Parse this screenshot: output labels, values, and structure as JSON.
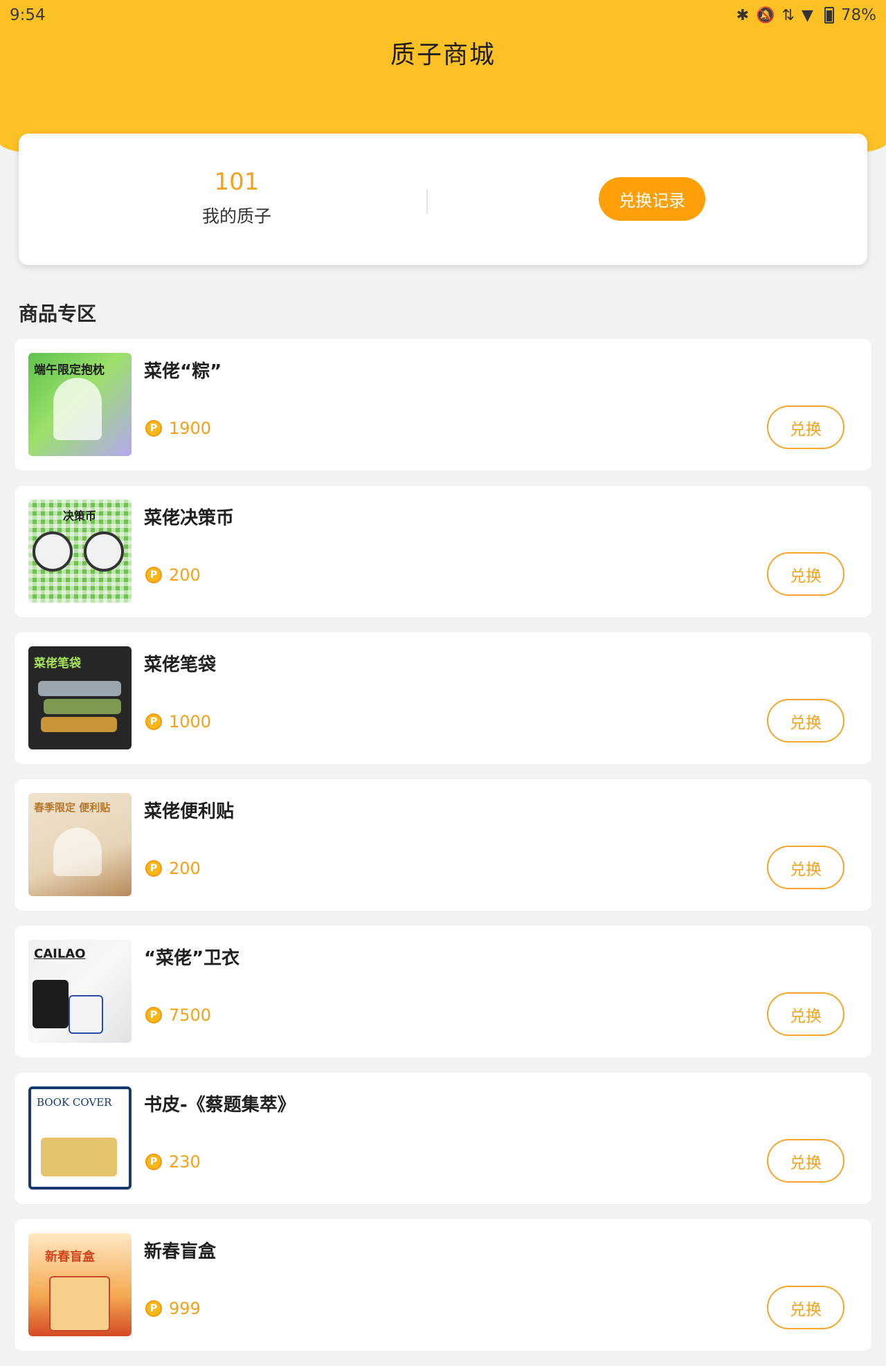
{
  "status_bar": {
    "time": "9:54",
    "battery": "78%",
    "icons": [
      "bluetooth-icon",
      "bell-off-icon",
      "data-arrows-icon",
      "wifi-icon",
      "battery-icon"
    ]
  },
  "header": {
    "title": "质子商城"
  },
  "summary": {
    "points_value": "101",
    "points_label": "我的质子",
    "history_button": "兑换记录"
  },
  "section_title": "商品专区",
  "products": [
    {
      "name": "菜佬“粽”",
      "price": "1900",
      "button": "兑换",
      "thumb_text": "端午限定抱枕"
    },
    {
      "name": "菜佬决策币",
      "price": "200",
      "button": "兑换",
      "thumb_text": "决策币"
    },
    {
      "name": "菜佬笔袋",
      "price": "1000",
      "button": "兑换",
      "thumb_text": "菜佬笔袋"
    },
    {
      "name": "菜佬便利贴",
      "price": "200",
      "button": "兑换",
      "thumb_text": "春季限定 便利贴"
    },
    {
      "name": "“菜佬”卫衣",
      "price": "7500",
      "button": "兑换",
      "thumb_text": "CAILAO"
    },
    {
      "name": "书皮-《蔡题集萃》",
      "price": "230",
      "button": "兑换",
      "thumb_text": "BOOK COVER"
    },
    {
      "name": "新春盲盒",
      "price": "999",
      "button": "兑换",
      "thumb_text": "新春盲盒"
    }
  ],
  "colors": {
    "header_yellow": "#fcc124",
    "accent_orange": "#ff9f0a",
    "price_orange": "#f5a11a",
    "background": "#f2f2f2"
  }
}
